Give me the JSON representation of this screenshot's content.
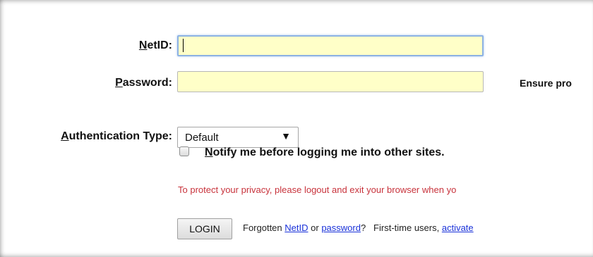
{
  "form": {
    "netid_label_key": "N",
    "netid_label_rest": "etID:",
    "netid_value": "",
    "password_label_key": "P",
    "password_label_rest": "assword:",
    "password_value": "",
    "password_hint": "Ensure pro",
    "auth_label_key": "A",
    "auth_label_rest": "uthentication Type:",
    "auth_selected": "Default",
    "notify_key": "N",
    "notify_rest": "otify me before logging me into other sites.",
    "notify_checked": false,
    "privacy_text": "To protect your privacy, please logout and exit your browser when yo",
    "login_label": "LOGIN",
    "footer_forgotten": "Forgotten",
    "footer_netid_link": "NetID",
    "footer_or": "or",
    "footer_password_link": "password",
    "footer_question": "?",
    "footer_first_time": "First-time users,",
    "footer_activate_link": "activate"
  },
  "colors": {
    "input_bg": "#ffffc8",
    "privacy_text": "#c8333c",
    "link": "#1a32d9",
    "focus_border": "#8db2e3"
  },
  "icons": {
    "select_arrow": "dropdown-arrow-icon"
  }
}
